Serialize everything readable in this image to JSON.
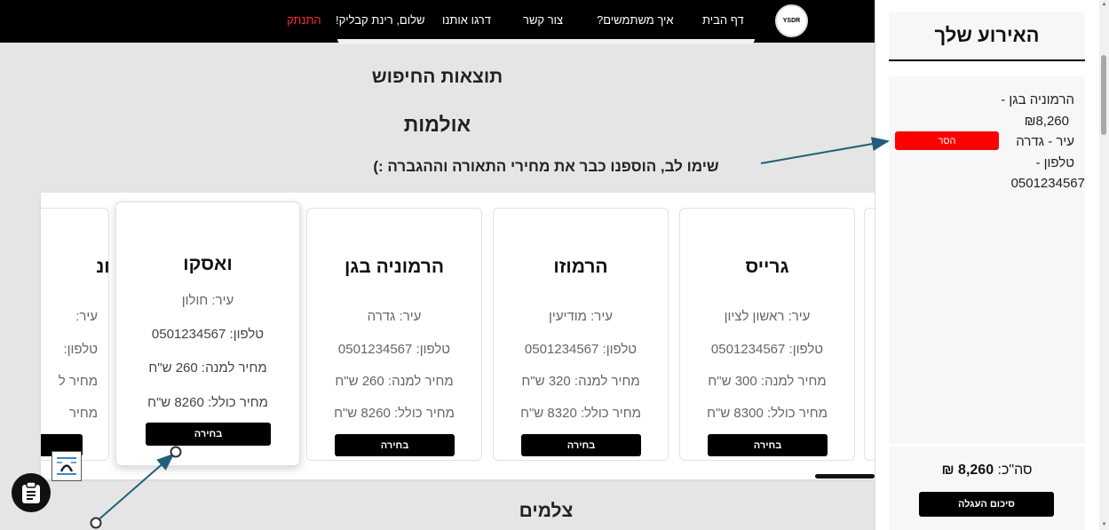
{
  "nav": {
    "items": [
      "דף הבית",
      "איך משתמשים?",
      "צור קשר",
      "דרגו אותנו",
      "שלום, רינת קבליק!",
      "התנתק"
    ],
    "logo_text": "YSDR",
    "logout_color": "#ff2b2b"
  },
  "page": {
    "search_results_title": "תוצאות החיפוש",
    "halls_title": "אולמות",
    "notice": "שימו לב, הוספנו כבר את מחירי התאורה וההגברה :)",
    "photographers_title": "צלמים"
  },
  "cards": [
    {
      "name": "גרייס",
      "city": "עיר: ראשון לציון",
      "phone": "טלפון: 0501234567",
      "price_per_plate": "מחיר למנה: 300 ש\"ח",
      "total_price": "מחיר כולל: 8300 ש\"ח",
      "button": "בחירה"
    },
    {
      "name": "הרמוזו",
      "city": "עיר: מודיעין",
      "phone": "טלפון: 0501234567",
      "price_per_plate": "מחיר למנה: 320 ש\"ח",
      "total_price": "מחיר כולל: 8320 ש\"ח",
      "button": "בחירה"
    },
    {
      "name": "הרמוניה בגן",
      "city": "עיר: גדרה",
      "phone": "טלפון: 0501234567",
      "price_per_plate": "מחיר למנה: 260 ש\"ח",
      "total_price": "מחיר כולל: 8260 ש\"ח",
      "button": "בחירה"
    },
    {
      "name": "ואסקו",
      "city": "עיר: חולון",
      "phone": "טלפון: 0501234567",
      "price_per_plate": "מחיר למנה: 260 ש\"ח",
      "total_price": "מחיר כולל: 8260 ש\"ח",
      "button": "בחירה"
    },
    {
      "name": "חנ",
      "city": "עיר:",
      "phone": "טלפון:",
      "price_per_plate": "מחיר ל",
      "total_price": "מחיר"
    }
  ],
  "sidebar": {
    "title": "האירוע שלך",
    "event_lines": [
      "הרמוניה בגן -",
      "₪8,260",
      "עיר - גדרה",
      "טלפון -",
      "0501234567"
    ],
    "remove_label": "הסר",
    "total_label": "סה\"כ:",
    "total_value": "8,260 ₪",
    "checkout_label": "סיכום העגלה"
  },
  "colors": {
    "accent_red": "#ff0000",
    "annotation_arrow": "#1f5f7a"
  },
  "icons": {
    "accessibility": "accessibility-icon",
    "notes": "clipboard-icon"
  }
}
